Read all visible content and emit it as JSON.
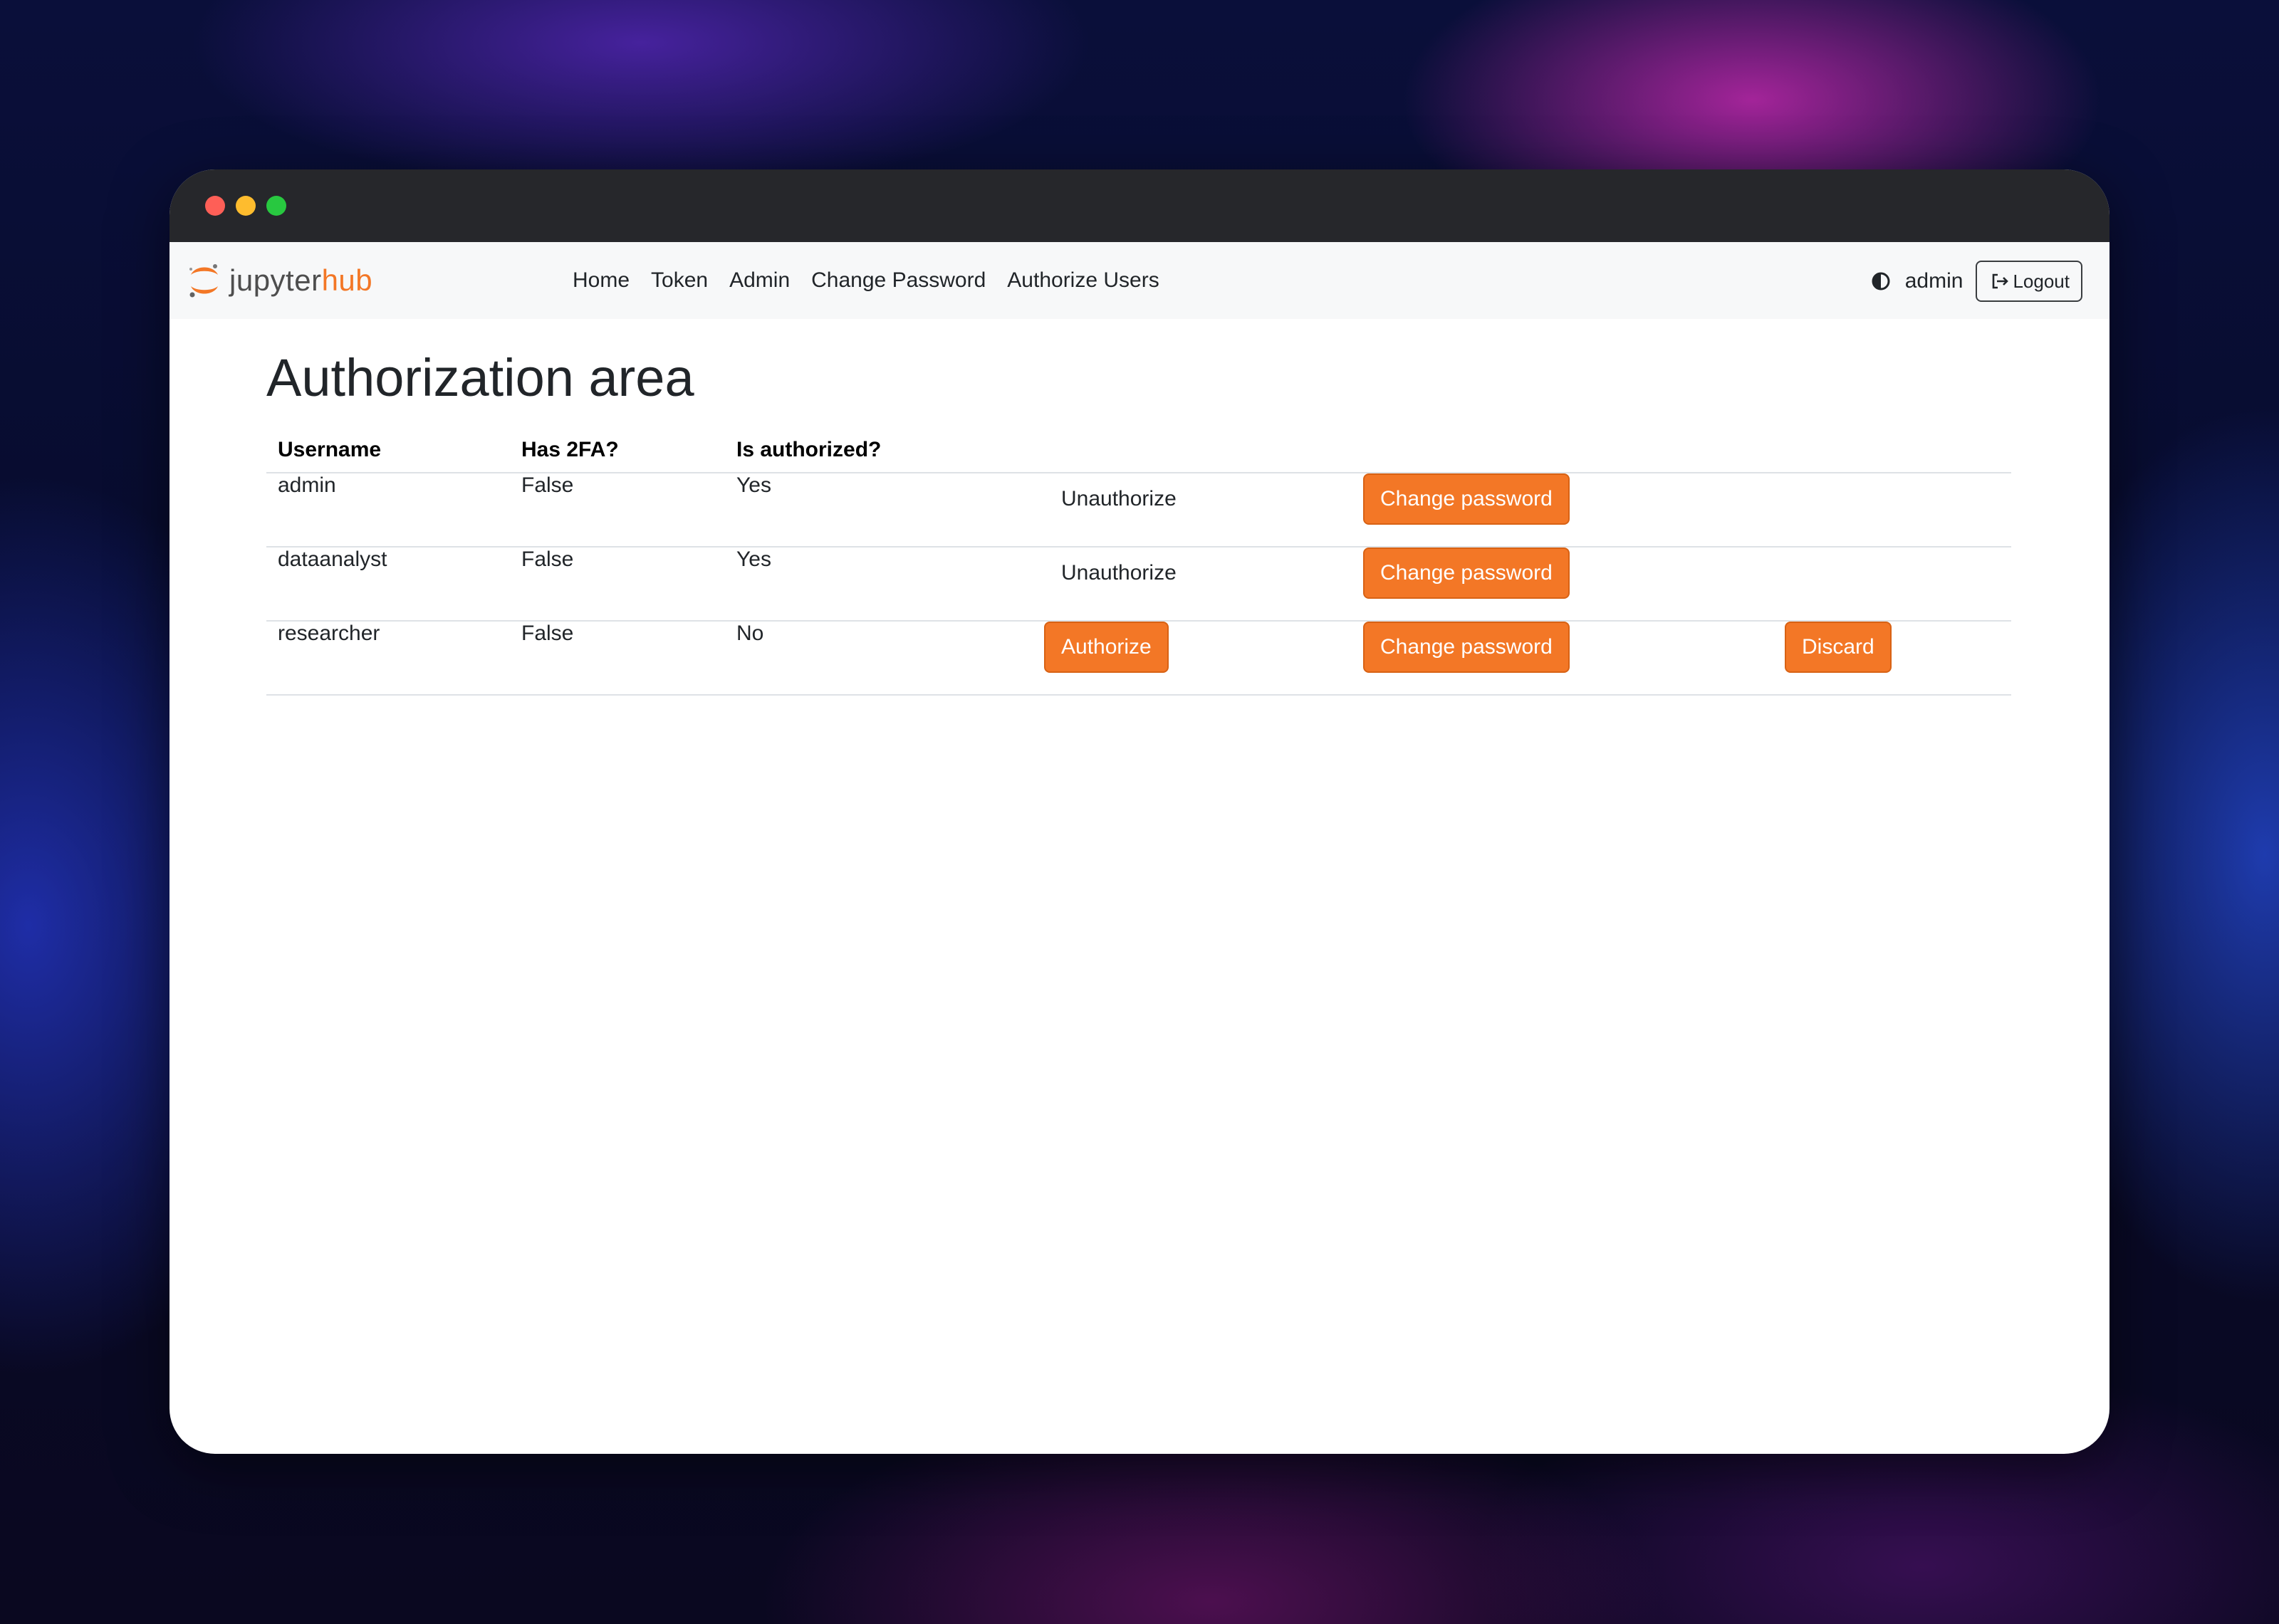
{
  "brand": {
    "name_part1": "jupyter",
    "name_part2": "hub",
    "logo_icon": "jupyter-logo-icon"
  },
  "nav": {
    "links": [
      "Home",
      "Token",
      "Admin",
      "Change Password",
      "Authorize Users"
    ],
    "theme_icon": "contrast-icon",
    "user": "admin",
    "logout_label": "Logout",
    "logout_icon": "logout-arrow-icon"
  },
  "page": {
    "title": "Authorization area"
  },
  "table": {
    "headers": [
      "Username",
      "Has 2FA?",
      "Is authorized?"
    ],
    "rows": [
      {
        "username": "admin",
        "has_2fa": "False",
        "is_authorized": "Yes",
        "auth_action": "Unauthorize",
        "password_action": "Change password"
      },
      {
        "username": "dataanalyst",
        "has_2fa": "False",
        "is_authorized": "Yes",
        "auth_action": "Unauthorize",
        "password_action": "Change password"
      },
      {
        "username": "researcher",
        "has_2fa": "False",
        "is_authorized": "No",
        "auth_action": "Authorize",
        "password_action": "Change password",
        "discard_action": "Discard"
      }
    ]
  },
  "colors": {
    "accent": "#f37726",
    "titlebar": "#26272b",
    "navbar": "#f7f8f9"
  }
}
